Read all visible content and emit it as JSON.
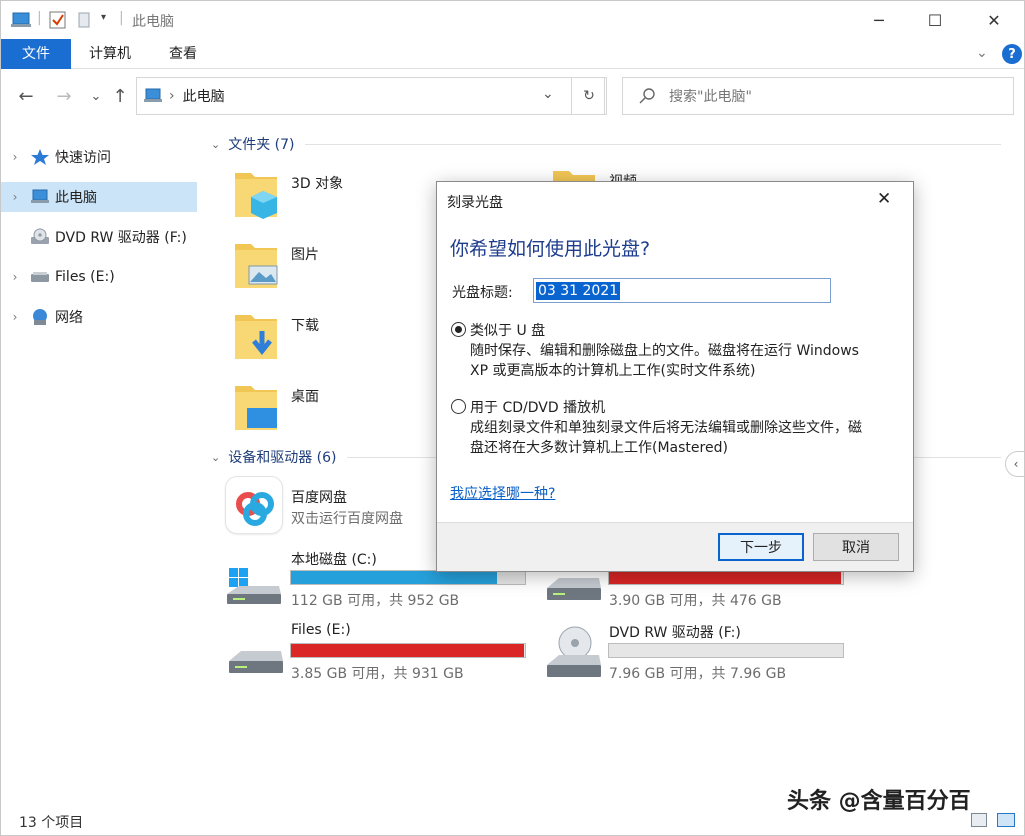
{
  "window": {
    "title": "此电脑",
    "minimize": "─",
    "maximize": "☐",
    "close": "✕"
  },
  "ribbon": {
    "tabs": [
      {
        "label": "文件"
      },
      {
        "label": "计算机"
      },
      {
        "label": "查看"
      }
    ],
    "help": "?"
  },
  "nav": {
    "back": "←",
    "forward": "→",
    "recent": "⌄",
    "up": "↑",
    "breadcrumb_sep": "›",
    "address": "此电脑",
    "address_dropdown": "⌄",
    "refresh": "↻",
    "search_placeholder": "搜索\"此电脑\""
  },
  "sidebar": {
    "items": [
      {
        "label": "快速访问"
      },
      {
        "label": "此电脑"
      },
      {
        "label": "DVD RW 驱动器 (F:)"
      },
      {
        "label": "Files (E:)"
      },
      {
        "label": "网络"
      }
    ]
  },
  "content": {
    "folders_header": "文件夹 (7)",
    "folders": [
      {
        "label": "3D 对象"
      },
      {
        "label": "视频"
      },
      {
        "label": "图片"
      },
      {
        "label": "下载"
      },
      {
        "label": "桌面"
      }
    ],
    "devices_header": "设备和驱动器 (6)",
    "devices": [
      {
        "name": "百度网盘",
        "sub": "双击运行百度网盘"
      },
      {
        "name": "本地磁盘 (C:)",
        "sub": "112 GB 可用，共 952 GB",
        "used_fraction": 0.88,
        "bar_color": "#26a0da"
      },
      {
        "name": "",
        "sub": "3.90 GB 可用，共 476 GB",
        "used_fraction": 0.99,
        "bar_color": "#da2626"
      },
      {
        "name": "Files (E:)",
        "sub": "3.85 GB 可用，共 931 GB",
        "used_fraction": 0.996,
        "bar_color": "#da2626"
      },
      {
        "name": "DVD RW 驱动器 (F:)",
        "sub": "7.96 GB 可用，共 7.96 GB",
        "used_fraction": 0.0,
        "bar_color": "#26a0da"
      }
    ]
  },
  "dialog": {
    "title": "刻录光盘",
    "close": "✕",
    "heading": "你希望如何使用此光盘?",
    "disc_title_label": "光盘标题:",
    "disc_title_value": "03 31 2021",
    "option1_label": "类似于 U 盘",
    "option1_desc_line1": "随时保存、编辑和删除磁盘上的文件。磁盘将在运行 Windows",
    "option1_desc_line2": "XP 或更高版本的计算机上工作(实时文件系统)",
    "option2_label": "用于 CD/DVD 播放机",
    "option2_desc_line1": "成组刻录文件和单独刻录文件后将无法编辑或删除这些文件，磁",
    "option2_desc_line2": "盘还将在大多数计算机上工作(Mastered)",
    "help_link": "我应选择哪一种?",
    "next_button": "下一步",
    "cancel_button": "取消"
  },
  "status": {
    "item_count": "13 个项目"
  },
  "watermark": "头条 @含量百分百"
}
